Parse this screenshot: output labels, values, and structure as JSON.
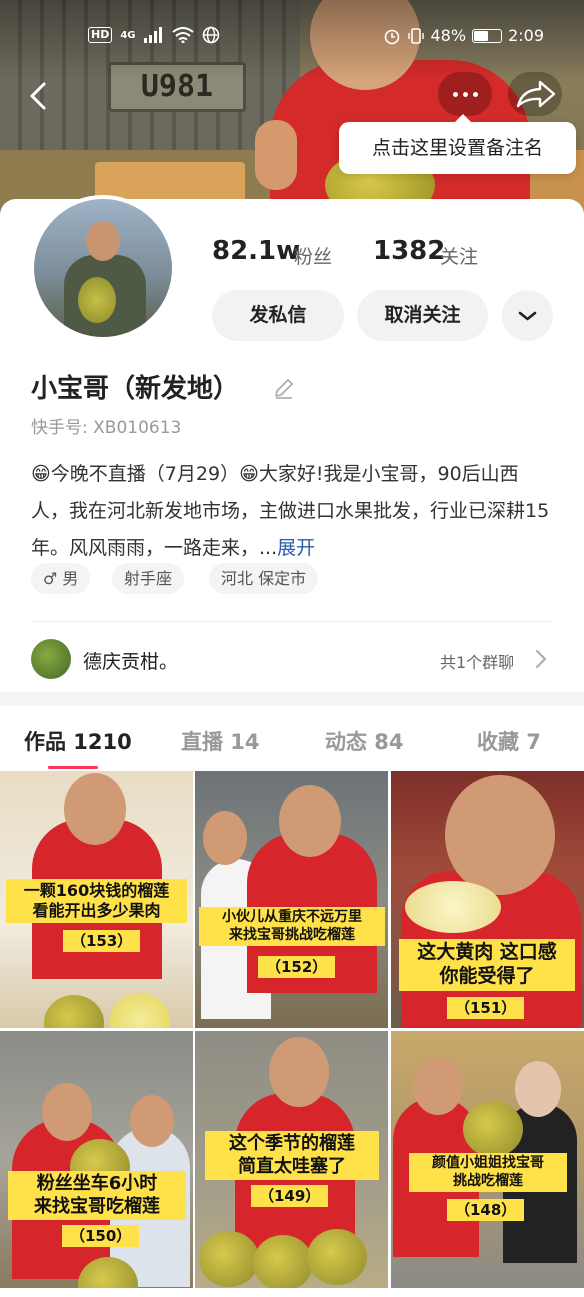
{
  "status_bar": {
    "hd": "HD",
    "network": "4G",
    "battery_text": "48%",
    "battery_level": 0.48,
    "time": "2:09"
  },
  "banner": {
    "plate_text": "U981",
    "tooltip": "点击这里设置备注名"
  },
  "profile": {
    "followers_count": "82.1w",
    "followers_label": "粉丝",
    "following_count": "1382",
    "following_label": "关注",
    "message_button": "发私信",
    "unfollow_button": "取消关注",
    "nickname": "小宝哥（新发地）",
    "kuaishou_id": "快手号: XB010613",
    "bio": "😁今晚不直播（7月29）😁大家好!我是小宝哥，90后山西人，我在河北新发地市场，主做进口水果批发，行业已深耕15年。风风雨雨，一路走来，",
    "bio_ellipsis": "...",
    "expand_label": "展开",
    "tags": [
      "♂ 男",
      "射手座",
      "河北 保定市"
    ]
  },
  "group": {
    "name": "德庆贡柑。",
    "count_label": "共1个群聊"
  },
  "tabs": [
    {
      "label": "作品 1210",
      "active": true
    },
    {
      "label": "直播 14",
      "active": false
    },
    {
      "label": "动态 84",
      "active": false
    },
    {
      "label": "收藏 7",
      "active": false
    }
  ],
  "videos": [
    {
      "caption_line1": "一颗160块钱的榴莲",
      "caption_line2": "看能开出多少果肉",
      "number": "（153）"
    },
    {
      "caption_line1": "小伙儿从重庆不远万里",
      "caption_line2": "来找宝哥挑战吃榴莲",
      "number": "（152）"
    },
    {
      "caption_line1": "这大黄肉 这口感",
      "caption_line2": "你能受得了",
      "number": "（151）"
    },
    {
      "caption_line1": "粉丝坐车6小时",
      "caption_line2": "来找宝哥吃榴莲",
      "number": "（150）"
    },
    {
      "caption_line1": "这个季节的榴莲",
      "caption_line2": "简直太哇塞了",
      "number": "（149）"
    },
    {
      "caption_line1": "颜值小姐姐找宝哥",
      "caption_line2": "挑战吃榴莲",
      "number": "（148）"
    }
  ],
  "colors": {
    "accent": "#fe3355",
    "caption_bg": "#ffe14a",
    "link": "#2a5ca8",
    "shirt_red": "#d7262b"
  }
}
